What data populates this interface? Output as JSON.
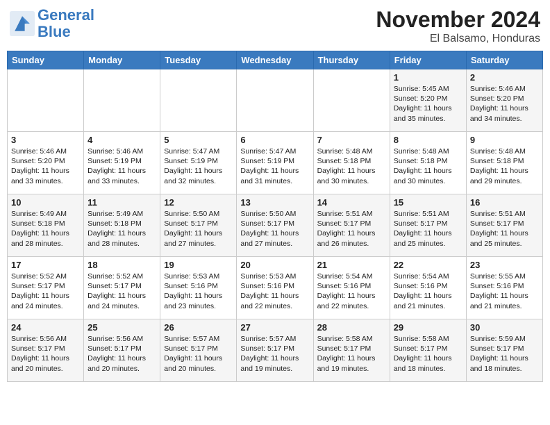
{
  "header": {
    "logo_line1": "General",
    "logo_line2": "Blue",
    "title": "November 2024",
    "subtitle": "El Balsamo, Honduras"
  },
  "weekdays": [
    "Sunday",
    "Monday",
    "Tuesday",
    "Wednesday",
    "Thursday",
    "Friday",
    "Saturday"
  ],
  "weeks": [
    [
      {
        "day": "",
        "info": ""
      },
      {
        "day": "",
        "info": ""
      },
      {
        "day": "",
        "info": ""
      },
      {
        "day": "",
        "info": ""
      },
      {
        "day": "",
        "info": ""
      },
      {
        "day": "1",
        "info": "Sunrise: 5:45 AM\nSunset: 5:20 PM\nDaylight: 11 hours and 35 minutes."
      },
      {
        "day": "2",
        "info": "Sunrise: 5:46 AM\nSunset: 5:20 PM\nDaylight: 11 hours and 34 minutes."
      }
    ],
    [
      {
        "day": "3",
        "info": "Sunrise: 5:46 AM\nSunset: 5:20 PM\nDaylight: 11 hours and 33 minutes."
      },
      {
        "day": "4",
        "info": "Sunrise: 5:46 AM\nSunset: 5:19 PM\nDaylight: 11 hours and 33 minutes."
      },
      {
        "day": "5",
        "info": "Sunrise: 5:47 AM\nSunset: 5:19 PM\nDaylight: 11 hours and 32 minutes."
      },
      {
        "day": "6",
        "info": "Sunrise: 5:47 AM\nSunset: 5:19 PM\nDaylight: 11 hours and 31 minutes."
      },
      {
        "day": "7",
        "info": "Sunrise: 5:48 AM\nSunset: 5:18 PM\nDaylight: 11 hours and 30 minutes."
      },
      {
        "day": "8",
        "info": "Sunrise: 5:48 AM\nSunset: 5:18 PM\nDaylight: 11 hours and 30 minutes."
      },
      {
        "day": "9",
        "info": "Sunrise: 5:48 AM\nSunset: 5:18 PM\nDaylight: 11 hours and 29 minutes."
      }
    ],
    [
      {
        "day": "10",
        "info": "Sunrise: 5:49 AM\nSunset: 5:18 PM\nDaylight: 11 hours and 28 minutes."
      },
      {
        "day": "11",
        "info": "Sunrise: 5:49 AM\nSunset: 5:18 PM\nDaylight: 11 hours and 28 minutes."
      },
      {
        "day": "12",
        "info": "Sunrise: 5:50 AM\nSunset: 5:17 PM\nDaylight: 11 hours and 27 minutes."
      },
      {
        "day": "13",
        "info": "Sunrise: 5:50 AM\nSunset: 5:17 PM\nDaylight: 11 hours and 27 minutes."
      },
      {
        "day": "14",
        "info": "Sunrise: 5:51 AM\nSunset: 5:17 PM\nDaylight: 11 hours and 26 minutes."
      },
      {
        "day": "15",
        "info": "Sunrise: 5:51 AM\nSunset: 5:17 PM\nDaylight: 11 hours and 25 minutes."
      },
      {
        "day": "16",
        "info": "Sunrise: 5:51 AM\nSunset: 5:17 PM\nDaylight: 11 hours and 25 minutes."
      }
    ],
    [
      {
        "day": "17",
        "info": "Sunrise: 5:52 AM\nSunset: 5:17 PM\nDaylight: 11 hours and 24 minutes."
      },
      {
        "day": "18",
        "info": "Sunrise: 5:52 AM\nSunset: 5:17 PM\nDaylight: 11 hours and 24 minutes."
      },
      {
        "day": "19",
        "info": "Sunrise: 5:53 AM\nSunset: 5:16 PM\nDaylight: 11 hours and 23 minutes."
      },
      {
        "day": "20",
        "info": "Sunrise: 5:53 AM\nSunset: 5:16 PM\nDaylight: 11 hours and 22 minutes."
      },
      {
        "day": "21",
        "info": "Sunrise: 5:54 AM\nSunset: 5:16 PM\nDaylight: 11 hours and 22 minutes."
      },
      {
        "day": "22",
        "info": "Sunrise: 5:54 AM\nSunset: 5:16 PM\nDaylight: 11 hours and 21 minutes."
      },
      {
        "day": "23",
        "info": "Sunrise: 5:55 AM\nSunset: 5:16 PM\nDaylight: 11 hours and 21 minutes."
      }
    ],
    [
      {
        "day": "24",
        "info": "Sunrise: 5:56 AM\nSunset: 5:17 PM\nDaylight: 11 hours and 20 minutes."
      },
      {
        "day": "25",
        "info": "Sunrise: 5:56 AM\nSunset: 5:17 PM\nDaylight: 11 hours and 20 minutes."
      },
      {
        "day": "26",
        "info": "Sunrise: 5:57 AM\nSunset: 5:17 PM\nDaylight: 11 hours and 20 minutes."
      },
      {
        "day": "27",
        "info": "Sunrise: 5:57 AM\nSunset: 5:17 PM\nDaylight: 11 hours and 19 minutes."
      },
      {
        "day": "28",
        "info": "Sunrise: 5:58 AM\nSunset: 5:17 PM\nDaylight: 11 hours and 19 minutes."
      },
      {
        "day": "29",
        "info": "Sunrise: 5:58 AM\nSunset: 5:17 PM\nDaylight: 11 hours and 18 minutes."
      },
      {
        "day": "30",
        "info": "Sunrise: 5:59 AM\nSunset: 5:17 PM\nDaylight: 11 hours and 18 minutes."
      }
    ]
  ]
}
